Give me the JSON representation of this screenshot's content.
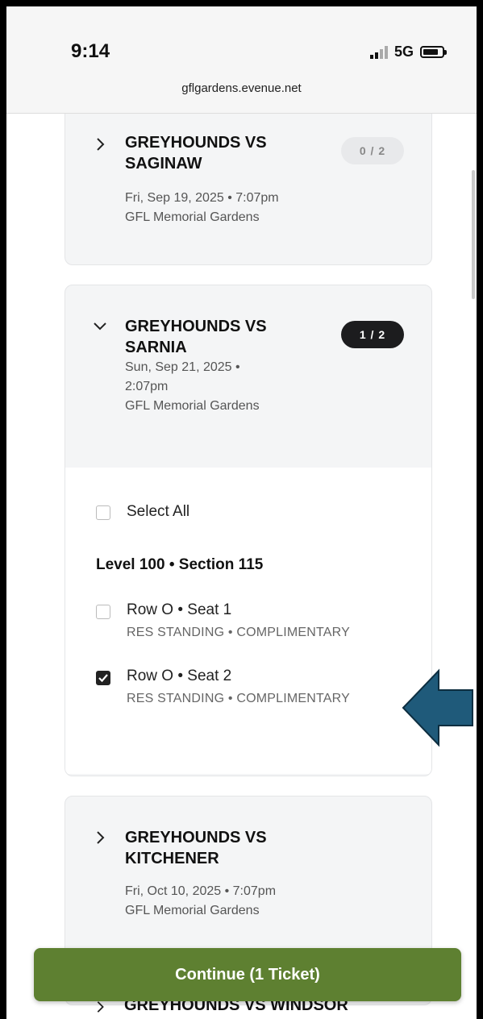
{
  "status": {
    "time": "9:14",
    "network": "5G"
  },
  "browser": {
    "url": "gflgardens.evenue.net"
  },
  "events": [
    {
      "title_line1": "GREYHOUNDS VS",
      "title_line2": "SAGINAW",
      "datetime": "Fri, Sep 19, 2025 • 7:07pm",
      "venue": "GFL Memorial Gardens",
      "count": "0 / 2",
      "expanded": false
    },
    {
      "title_line1": "GREYHOUNDS VS",
      "title_line2": "SARNIA",
      "datetime_line1": "Sun, Sep 21, 2025 •",
      "datetime_line2": "2:07pm",
      "venue": "GFL Memorial Gardens",
      "count": "1 / 2",
      "expanded": true,
      "select_all_label": "Select All",
      "section": "Level 100 • Section 115",
      "seats": [
        {
          "label": "Row O • Seat 1",
          "type": "RES STANDING • COMPLIMENTARY",
          "checked": false
        },
        {
          "label": "Row O • Seat 2",
          "type": "RES STANDING • COMPLIMENTARY",
          "checked": true
        }
      ]
    },
    {
      "title_line1": "GREYHOUNDS VS",
      "title_line2": "KITCHENER",
      "datetime": "Fri, Oct 10, 2025 • 7:07pm",
      "venue": "GFL Memorial Gardens",
      "expanded": false
    },
    {
      "title_peek": "GREYHOUNDS VS WINDSOR"
    }
  ],
  "continue_button": "Continue (1 Ticket)",
  "icons": [
    "chevron-right-icon",
    "chevron-down-icon",
    "checkbox-icon",
    "signal-icon",
    "battery-icon",
    "pointer-arrow-icon"
  ],
  "colors": {
    "continue": "#5e8031",
    "arrow": "#1f5a7a",
    "pill_dark": "#1c1c1e"
  }
}
